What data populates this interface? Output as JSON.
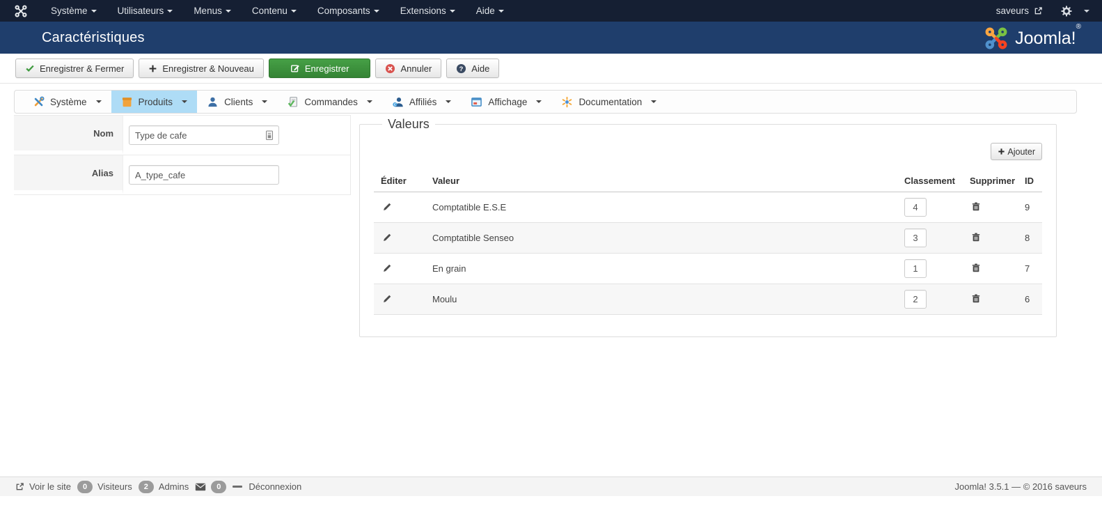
{
  "topbar": {
    "menus": [
      {
        "label": "Système"
      },
      {
        "label": "Utilisateurs"
      },
      {
        "label": "Menus"
      },
      {
        "label": "Contenu"
      },
      {
        "label": "Composants"
      },
      {
        "label": "Extensions"
      },
      {
        "label": "Aide"
      }
    ],
    "site_link": "saveurs"
  },
  "header": {
    "title": "Caractéristiques",
    "brand": "Joomla!",
    "brand_reg": "®"
  },
  "toolbar": {
    "save_close_label": "Enregistrer & Fermer",
    "save_new_label": "Enregistrer & Nouveau",
    "save_label": "Enregistrer",
    "cancel_label": "Annuler",
    "help_label": "Aide"
  },
  "component_menu": {
    "items": [
      {
        "label": "Système",
        "active": false
      },
      {
        "label": "Produits",
        "active": true
      },
      {
        "label": "Clients",
        "active": false
      },
      {
        "label": "Commandes",
        "active": false
      },
      {
        "label": "Affiliés",
        "active": false
      },
      {
        "label": "Affichage",
        "active": false
      },
      {
        "label": "Documentation",
        "active": false
      }
    ]
  },
  "form": {
    "fields": [
      {
        "label": "Nom",
        "value": "Type de cafe"
      },
      {
        "label": "Alias",
        "value": "A_type_cafe"
      }
    ]
  },
  "values_panel": {
    "legend": "Valeurs",
    "add_label": "Ajouter",
    "columns": {
      "edit": "Éditer",
      "value": "Valeur",
      "ordering": "Classement",
      "delete": "Supprimer",
      "id": "ID"
    },
    "rows": [
      {
        "value": "Comptatible E.S.E",
        "ordering": "4",
        "id": "9"
      },
      {
        "value": "Comptatible Senseo",
        "ordering": "3",
        "id": "8"
      },
      {
        "value": "En grain",
        "ordering": "1",
        "id": "7"
      },
      {
        "value": "Moulu",
        "ordering": "2",
        "id": "6"
      }
    ]
  },
  "footer": {
    "view_site": "Voir le site",
    "visitors_count": "0",
    "visitors_label": "Visiteurs",
    "admins_count": "2",
    "admins_label": "Admins",
    "messages_count": "0",
    "logout": "Déconnexion",
    "version": "Joomla! 3.5.1 — © 2016 saveurs"
  },
  "colors": {
    "topbar_bg": "#151f33",
    "header_bg": "#1f3e6c",
    "active_tab_bg": "#aedcf6",
    "save_button_green": "#3f9a3f",
    "cancel_red": "#d9534f"
  }
}
